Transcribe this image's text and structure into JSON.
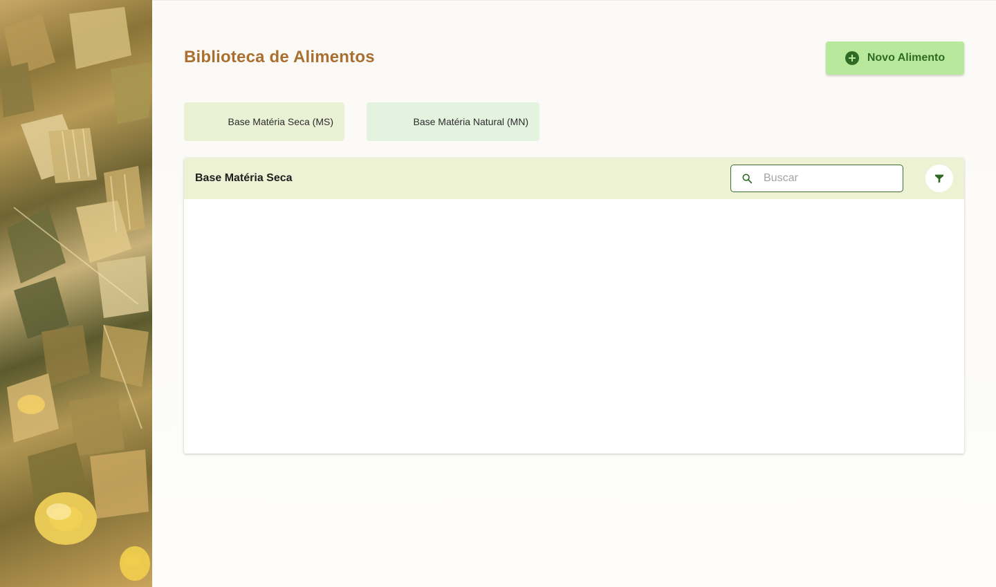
{
  "page": {
    "title": "Biblioteca de Alimentos"
  },
  "actions": {
    "new_food_label": "Novo Alimento",
    "new_food_icon": "plus-circle-icon"
  },
  "tabs": [
    {
      "label": "Base Matéria Seca (MS)",
      "selected": true
    },
    {
      "label": "Base Matéria Natural (MN)",
      "selected": false
    }
  ],
  "table": {
    "title": "Base Matéria Seca",
    "search": {
      "value": "",
      "placeholder": "Buscar",
      "icon": "search-icon"
    },
    "filter_icon": "filter-icon",
    "rows": []
  },
  "colors": {
    "title": "#a86f30",
    "primary_button_bg": "#b8e89c",
    "primary_button_text": "#2f6a25",
    "tab_ms_bg": "#eaf1d4",
    "tab_mn_bg": "#e4f3df",
    "table_header_bg": "#ecf2d3",
    "accent_dark_green": "#3d6b2c"
  }
}
